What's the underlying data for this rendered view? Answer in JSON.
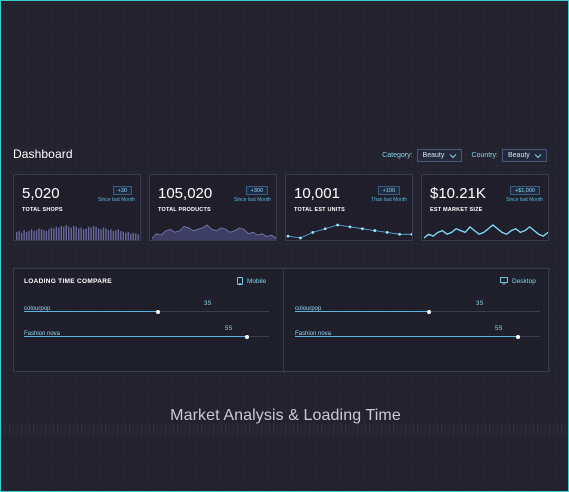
{
  "dashboard": {
    "title": "Dashboard",
    "filters": {
      "category_label": "Category:",
      "category_value": "Beauty",
      "country_label": "Country:",
      "country_value": "Beauty"
    },
    "kpis": [
      {
        "value": "5,020",
        "label": "TOTAL SHOPS",
        "delta": "+30",
        "since": "Since last Month",
        "chart": "bars",
        "series": [
          6,
          7,
          5,
          8,
          6,
          7,
          9,
          7,
          8,
          10,
          9,
          8,
          7,
          9,
          11,
          10,
          12,
          11,
          13,
          12,
          14,
          12,
          11,
          13,
          12,
          10,
          11,
          9,
          10,
          12,
          11,
          13,
          12,
          10,
          9,
          11,
          10,
          8,
          9,
          7,
          8,
          9,
          7,
          6,
          5,
          6,
          4,
          5,
          4,
          3
        ]
      },
      {
        "value": "105,020",
        "label": "TOTAL PRODUCTS",
        "delta": "+300",
        "since": "Since last Month",
        "chart": "area",
        "series": [
          6,
          9,
          8,
          11,
          12,
          10,
          11,
          14,
          13,
          11,
          12,
          13,
          15,
          12,
          11,
          13,
          12,
          10,
          11,
          13,
          12,
          9,
          10,
          8,
          9,
          7,
          8,
          6
        ]
      },
      {
        "value": "10,001",
        "label": "TOTAL EST UNITS",
        "delta": "+100",
        "since": "Than last  Month",
        "chart": "line-dots",
        "series": [
          4,
          3,
          6,
          8,
          10,
          9,
          8,
          7,
          6,
          5,
          5
        ]
      },
      {
        "value": "$10.21K",
        "label": "EST MARKET SIZE",
        "delta": "+$1,000",
        "since": "Since last Month",
        "chart": "wave",
        "series": [
          4,
          6,
          5,
          7,
          8,
          6,
          7,
          9,
          8,
          7,
          10,
          8,
          6,
          7,
          9,
          11,
          9,
          7,
          6,
          8,
          9,
          7,
          8,
          10,
          8,
          6,
          5,
          7
        ]
      }
    ],
    "loading": {
      "title": "LOADING TIME COMPARE",
      "mobile": {
        "label": "Mobile",
        "rows": [
          {
            "name": "colourpop",
            "display": "3S",
            "seconds": 3
          },
          {
            "name": "Fashion nova",
            "display": "5S",
            "seconds": 5
          }
        ]
      },
      "desktop": {
        "label": "Desktop",
        "rows": [
          {
            "name": "colourpop",
            "display": "3S",
            "seconds": 3
          },
          {
            "name": "Fashion nova",
            "display": "5S",
            "seconds": 5
          }
        ]
      }
    }
  },
  "caption": "Market Analysis & Loading Time",
  "colors": {
    "accent": "#5fb4e0",
    "frame_border": "#36d1cf",
    "background": "#23222f",
    "bar_fill": "#6a6aa0",
    "area_fill": "#4a4a7a",
    "line": "#5fb4e0"
  }
}
